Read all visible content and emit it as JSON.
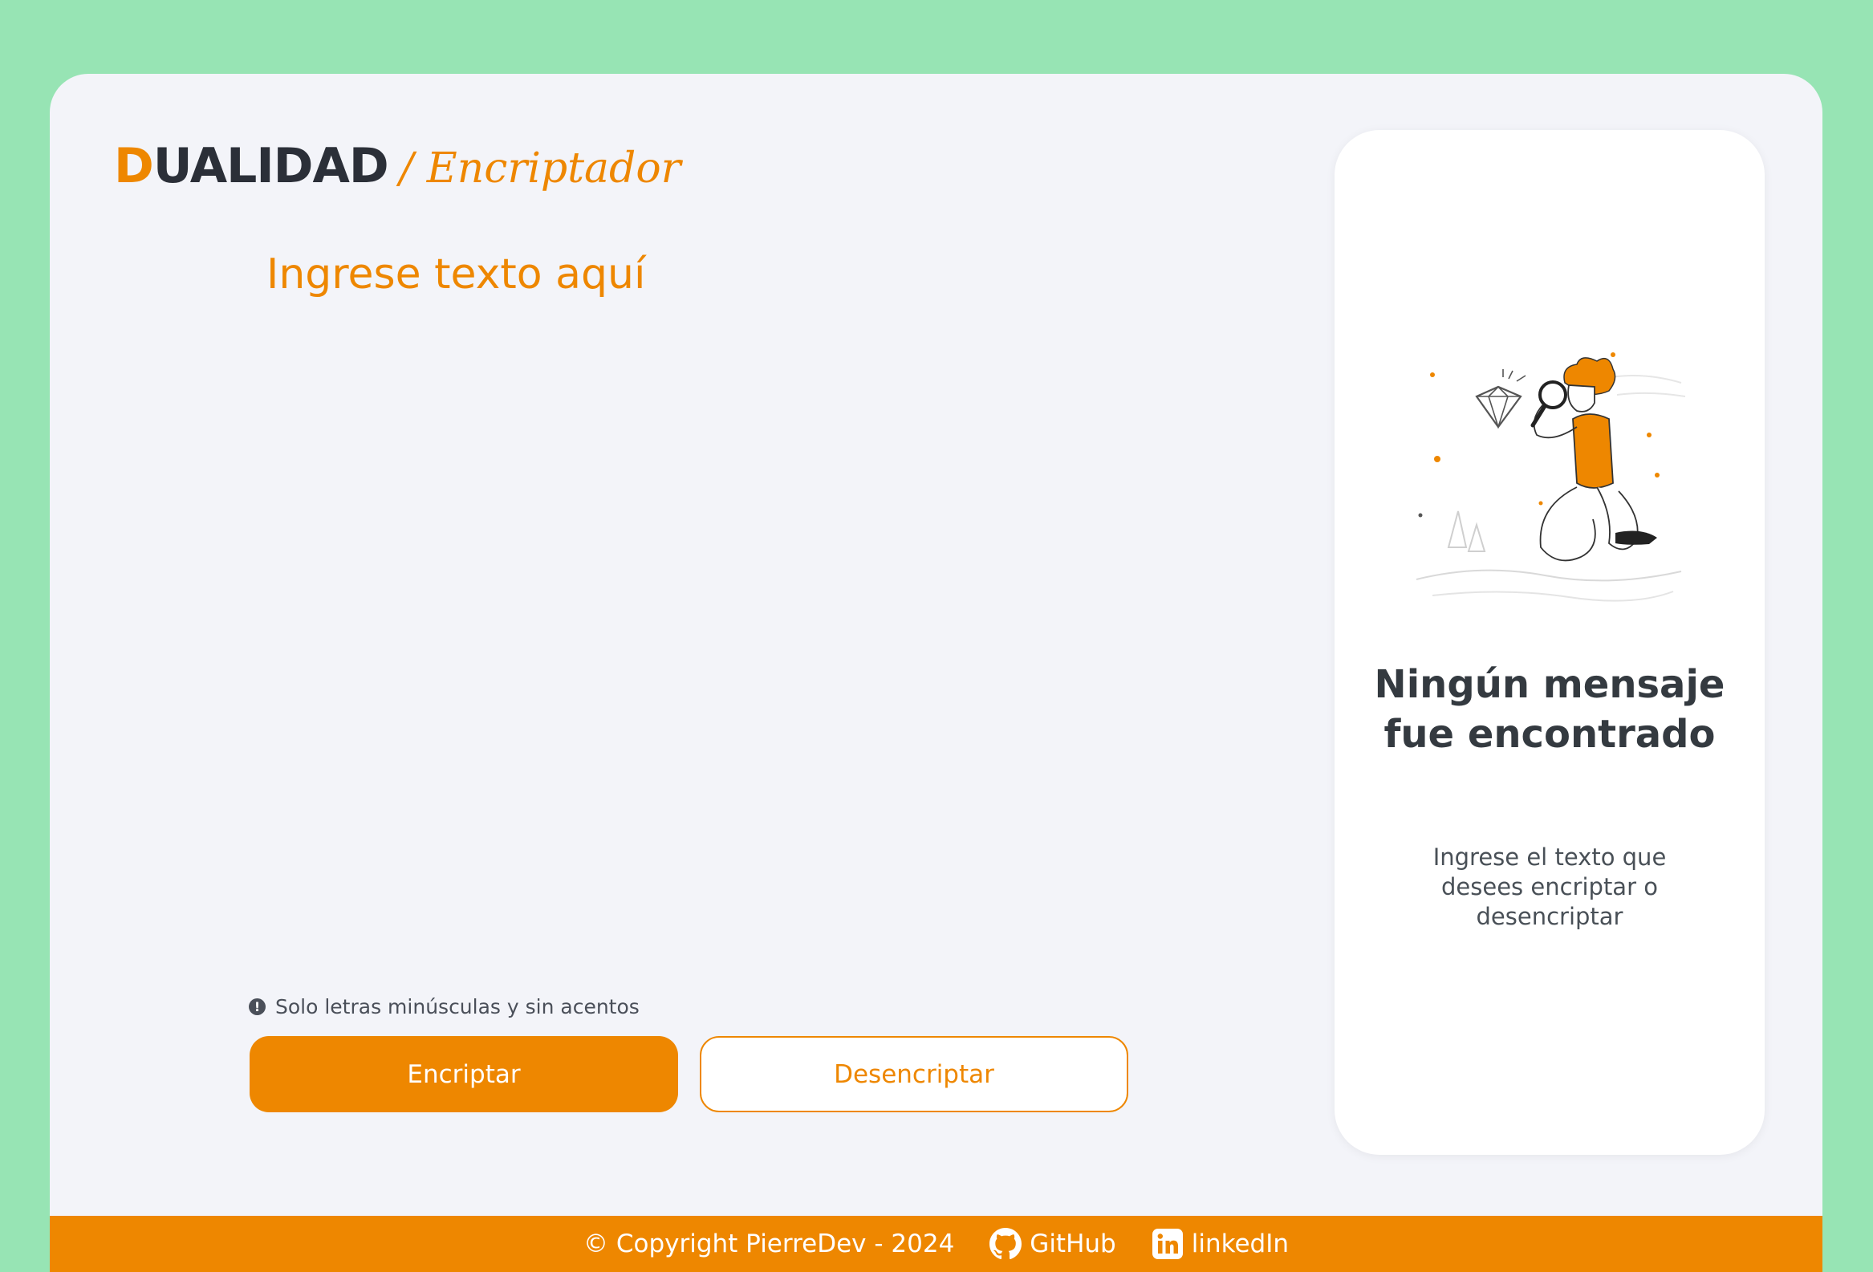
{
  "logo": {
    "first_letter": "D",
    "rest": "UALIDAD",
    "subtitle": "/ Encriptador"
  },
  "input": {
    "placeholder": "Ingrese texto aquí",
    "value": ""
  },
  "hint": {
    "icon": "info-icon",
    "text": "Solo letras minúsculas y sin acentos"
  },
  "buttons": {
    "encrypt": "Encriptar",
    "decrypt": "Desencriptar"
  },
  "output": {
    "title": "Ningún mensaje fue encontrado",
    "text": "Ingrese el texto que desees encriptar o desencriptar"
  },
  "footer": {
    "copyright": "© Copyright PierreDev - 2024",
    "github": "GitHub",
    "linkedin": "linkedIn"
  },
  "colors": {
    "background": "#97e4b4",
    "panel": "#f3f4f9",
    "accent": "#ee8700",
    "title": "#343a40"
  }
}
